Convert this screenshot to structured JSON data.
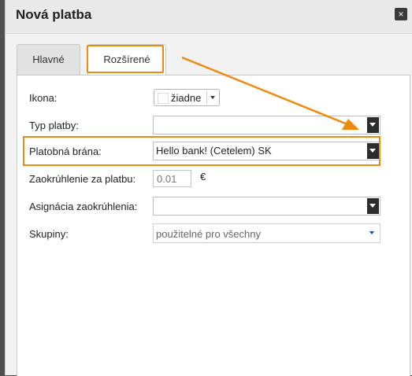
{
  "dialog": {
    "title": "Nová platba",
    "close_icon": "×"
  },
  "tabs": [
    {
      "label": "Hlavné",
      "active": false
    },
    {
      "label": "Rozšírené",
      "active": true
    }
  ],
  "form": {
    "icon": {
      "label": "Ikona:",
      "value": "žiadne"
    },
    "payment_type": {
      "label": "Typ platby:",
      "value": ""
    },
    "gateway": {
      "label": "Platobná brána:",
      "value": "Hello bank! (Cetelem) SK"
    },
    "rounding": {
      "label": "Zaokrúhlenie za platbu:",
      "value": "0.01",
      "unit": "€"
    },
    "rounding_assignment": {
      "label": "Asignácia zaokrúhlenia:",
      "value": ""
    },
    "groups": {
      "label": "Skupiny:",
      "value": "použitelné pro všechny"
    }
  },
  "annotation": {
    "color": "#ef8a10"
  }
}
